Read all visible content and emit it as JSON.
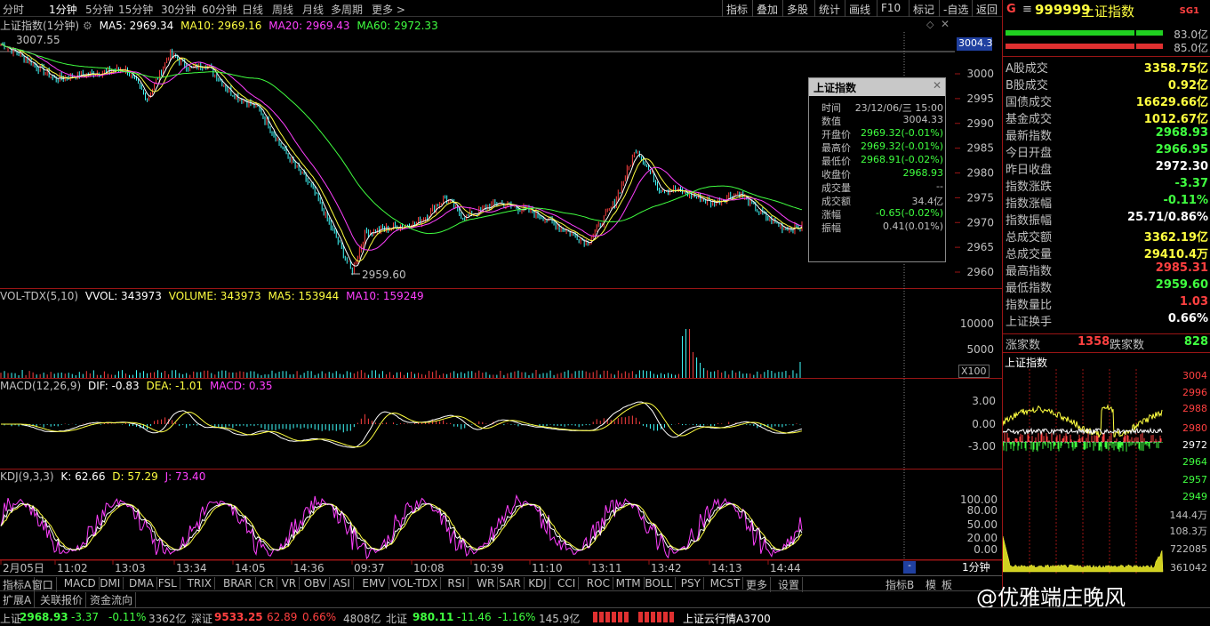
{
  "toolbar": {
    "periods": [
      "分时",
      "1分钟",
      "5分钟",
      "15分钟",
      "30分钟",
      "60分钟",
      "日线",
      "周线",
      "月线",
      "多周期",
      "更多 >"
    ],
    "active": "1分钟",
    "right": [
      "指标",
      "叠加",
      "多股",
      "统计",
      "画线",
      "F10",
      "标记",
      "-自选",
      "返回"
    ]
  },
  "main": {
    "title": "上证指数(1分钟)",
    "ma5": "MA5: 2969.34",
    "ma10": "MA10: 2969.16",
    "ma20": "MA20: 2969.43",
    "ma60": "MA60: 2972.33",
    "high_mark": "3007.55",
    "low_mark": "2959.60",
    "cur_price_tag": "3004.3",
    "yticks": [
      "3000",
      "2995",
      "2990",
      "2985",
      "2980",
      "2975",
      "2970",
      "2965",
      "2960"
    ]
  },
  "vol": {
    "title": "VOL-TDX(5,10)",
    "vvol": "VVOL: 343973",
    "volume": "VOLUME: 343973",
    "ma5": "MA5: 153944",
    "ma10": "MA10: 159249",
    "ytick": "5000",
    "scale": "X100",
    "ytick2": "10000"
  },
  "macd": {
    "title": "MACD(12,26,9)",
    "dif": "DIF: -0.83",
    "dea": "DEA: -1.01",
    "macd": "MACD: 0.35",
    "yticks": [
      "3.00",
      "0.00",
      "-3.00"
    ]
  },
  "kdj": {
    "title": "KDJ(9,3,3)",
    "k": "K: 62.66",
    "d": "D: 57.29",
    "j": "J: 73.40",
    "yticks": [
      "100.00",
      "80.00",
      "50.00",
      "20.00",
      "0.00"
    ]
  },
  "timeaxis": [
    "2月05日",
    "11:02",
    "13:03",
    "13:34",
    "14:05",
    "14:36",
    "09:37",
    "10:08",
    "10:39",
    "11:10",
    "13:11",
    "13:42",
    "14:13",
    "14:44"
  ],
  "period_label": "1分钟",
  "info": {
    "header": "上证指数",
    "rows": [
      {
        "k": "时间",
        "v": "23/12/06/三 15:00",
        "c": "#c0c0c0"
      },
      {
        "k": "数值",
        "v": "3004.33",
        "c": "#c0c0c0"
      },
      {
        "k": "开盘价",
        "v": "2969.32(-0.01%)",
        "c": "#40ff40"
      },
      {
        "k": "最高价",
        "v": "2969.32(-0.01%)",
        "c": "#40ff40"
      },
      {
        "k": "最低价",
        "v": "2968.91(-0.02%)",
        "c": "#40ff40"
      },
      {
        "k": "收盘价",
        "v": "2968.93",
        "c": "#40ff40"
      },
      {
        "k": "成交量",
        "v": "--",
        "c": "#c0c0c0"
      },
      {
        "k": "成交额",
        "v": "34.4亿",
        "c": "#c0c0c0"
      },
      {
        "k": "涨幅",
        "v": "-0.65(-0.02%)",
        "c": "#40ff40"
      },
      {
        "k": "振幅",
        "v": "0.41(0.01%)",
        "c": "#c0c0c0"
      }
    ]
  },
  "bottomtabs": [
    "指标A",
    "窗口",
    "MACD",
    "DMI",
    "DMA",
    "FSL",
    "TRIX",
    "BRAR",
    "CR",
    "VR",
    "OBV",
    "ASI",
    "EMV",
    "VOL-TDX",
    "RSI",
    "WR",
    "SAR",
    "KDJ",
    "CCI",
    "ROC",
    "MTM",
    "BOLL",
    "PSY",
    "MCST",
    "更多",
    "设置"
  ],
  "bottomright": [
    "指标B",
    "模",
    "板"
  ],
  "extrow": [
    "扩展A",
    "关联报价",
    "资金流向"
  ],
  "status": {
    "sh_label": "上证",
    "sh_val": "2968.93",
    "sh_chg": "-3.37",
    "sh_pct": "-0.11%",
    "sh_amt": "3362亿",
    "sz_label": "深证",
    "sz_val": "9533.25",
    "sz_chg": "62.89",
    "sz_pct": "0.66%",
    "sz_amt": "4808亿",
    "bz_label": "北证",
    "bz_val": "980.11",
    "bz_chg": "-11.46",
    "bz_pct": "-1.16%",
    "bz_amt": "145.9亿",
    "cloud": "上证云行情A3700"
  },
  "right": {
    "code": "999999",
    "name": "上证指数",
    "g": "G",
    "sg": "SG1",
    "bar1": "83.0亿",
    "bar2": "85.0亿",
    "items": [
      {
        "k": "A股成交",
        "v": "3358.75亿",
        "c": "#ffff40"
      },
      {
        "k": "B股成交",
        "v": "0.92亿",
        "c": "#ffff40"
      },
      {
        "k": "国债成交",
        "v": "16629.66亿",
        "c": "#ffff40"
      },
      {
        "k": "基金成交",
        "v": "1012.67亿",
        "c": "#ffff40"
      },
      {
        "k": "最新指数",
        "v": "2968.93",
        "c": "#40ff40"
      },
      {
        "k": "今日开盘",
        "v": "2966.95",
        "c": "#40ff40"
      },
      {
        "k": "昨日收盘",
        "v": "2972.30",
        "c": "#ffffff"
      },
      {
        "k": "指数涨跌",
        "v": "-3.37",
        "c": "#40ff40"
      },
      {
        "k": "指数涨幅",
        "v": "-0.11%",
        "c": "#40ff40"
      },
      {
        "k": "指数振幅",
        "v": "25.71/0.86%",
        "c": "#ffffff"
      },
      {
        "k": "总成交额",
        "v": "3362.19亿",
        "c": "#ffff40"
      },
      {
        "k": "总成交量",
        "v": "29410.4万",
        "c": "#ffff40"
      },
      {
        "k": "最高指数",
        "v": "2985.31",
        "c": "#ff4040"
      },
      {
        "k": "最低指数",
        "v": "2959.60",
        "c": "#40ff40"
      },
      {
        "k": "指数量比",
        "v": "1.03",
        "c": "#ff4040"
      },
      {
        "k": "上证换手",
        "v": "0.66%",
        "c": "#ffffff"
      }
    ],
    "up_label": "涨家数",
    "up": "1358",
    "down_label": "跌家数",
    "down": "828",
    "mini_title": "上证指数",
    "mini_ticks": [
      "3004",
      "2996",
      "2988",
      "2980",
      "2972",
      "2964",
      "2957",
      "2949",
      "144.4万",
      "108.3万",
      "722085",
      "361042"
    ]
  },
  "watermark": "@优雅端庄晚风",
  "colors": {
    "up": "#ff4040",
    "down": "#40ffff",
    "ma5": "#ffffff",
    "ma10": "#ffff40",
    "ma20": "#ff40ff",
    "ma60": "#40ff40",
    "grid": "#9a1515"
  }
}
